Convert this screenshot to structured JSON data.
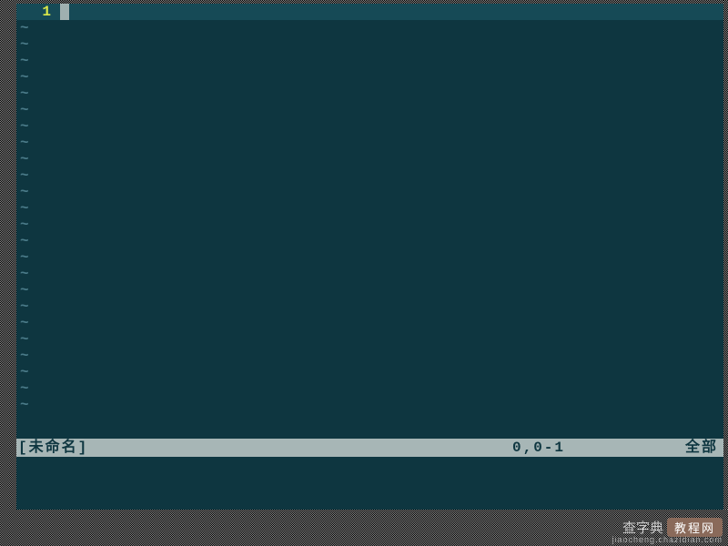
{
  "editor": {
    "current_line_number": "1",
    "tilde": "~",
    "tilde_count": 24,
    "cursor_visible": true
  },
  "status": {
    "filename": "[未命名]",
    "position": "0,0-1",
    "scroll": "全部"
  },
  "watermark": {
    "brand": "查字典",
    "badge": "教程网",
    "url": "jiaocheng.chazidian.com"
  }
}
